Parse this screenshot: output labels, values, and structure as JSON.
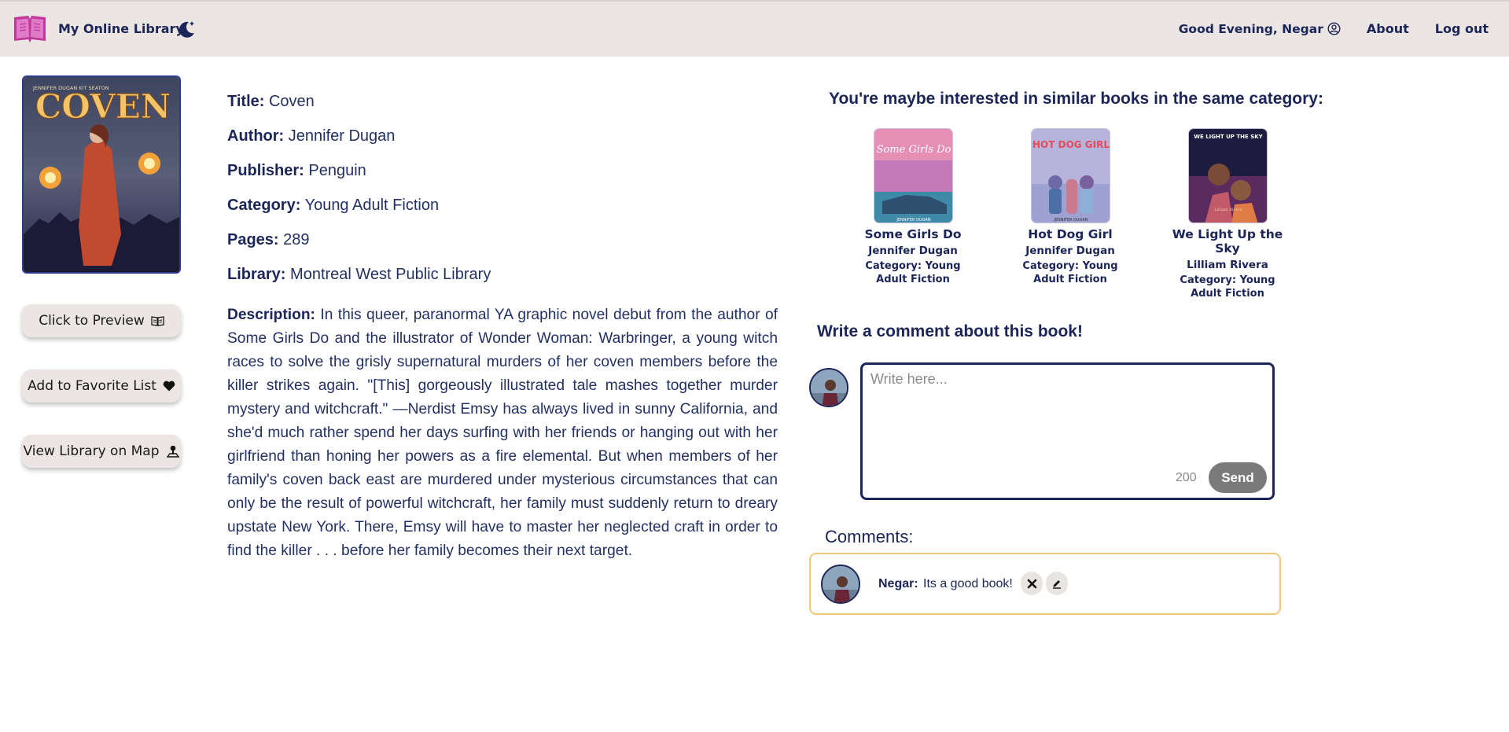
{
  "header": {
    "brand": "My Online Library",
    "greeting": "Good Evening, Negar",
    "about": "About",
    "logout": "Log out"
  },
  "book": {
    "cover_title": "COVEN",
    "cover_authors": "JENNIFER DUGAN    KIT SEATON",
    "fields": [
      {
        "label": "Title:",
        "value": "Coven"
      },
      {
        "label": "Author:",
        "value": "Jennifer Dugan"
      },
      {
        "label": "Publisher:",
        "value": "Penguin"
      },
      {
        "label": "Category:",
        "value": "Young Adult Fiction"
      },
      {
        "label": "Pages:",
        "value": "289"
      },
      {
        "label": "Library:",
        "value": "Montreal West Public Library"
      }
    ],
    "description_label": "Description:",
    "description": "In this queer, paranormal YA graphic novel debut from the author of Some Girls Do and the illustrator of Wonder Woman: Warbringer, a young witch races to solve the grisly supernatural murders of her coven members before the killer strikes again. \"[This] gorgeously illustrated tale mashes together murder mystery and witchcraft.\" —Nerdist Emsy has always lived in sunny California, and she'd much rather spend her days surfing with her friends or hanging out with her girlfriend than honing her powers as a fire elemental. But when members of her family's coven back east are murdered under mysterious circumstances that can only be the result of powerful witchcraft, her family must suddenly return to dreary upstate New York. There, Emsy will have to master her neglected craft in order to find the killer . . . before her family becomes their next target."
  },
  "actions": {
    "preview": "Click to Preview",
    "favorite": "Add to Favorite List",
    "map": "View Library on Map"
  },
  "similar": {
    "title": "You're maybe interested in similar books in the same category:",
    "books": [
      {
        "title": "Some Girls Do",
        "author": "Jennifer Dugan",
        "category": "Category:  Young Adult Fiction",
        "cover_text": "Some Girls Do",
        "cover_sub": "JENNIFER DUGAN"
      },
      {
        "title": "Hot Dog Girl",
        "author": "Jennifer Dugan",
        "category": "Category:  Young Adult Fiction",
        "cover_text": "HOT DOG GIRL",
        "cover_sub": "JENNIFER DUGAN"
      },
      {
        "title": "We Light Up the Sky",
        "author": "Lilliam Rivera",
        "category": "Category:  Young Adult Fiction",
        "cover_text": "WE LIGHT UP THE SKY",
        "cover_sub": "Lilliam Rivera"
      }
    ]
  },
  "comment_form": {
    "title": "Write a comment about this book!",
    "placeholder": "Write here...",
    "char_count": "200",
    "send": "Send"
  },
  "comments": {
    "title": "Comments:",
    "items": [
      {
        "author": "Negar:",
        "text": "Its a good book!"
      }
    ]
  }
}
